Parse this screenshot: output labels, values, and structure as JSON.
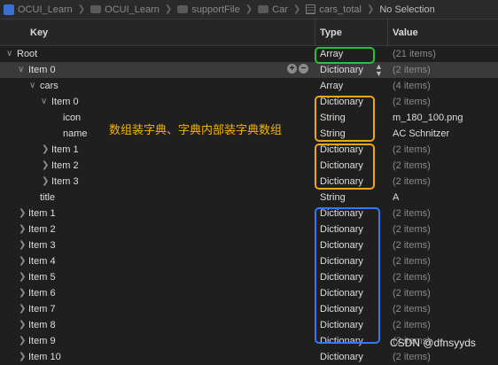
{
  "breadcrumbs": [
    "OCUI_Learn",
    "OCUI_Learn",
    "supportFile",
    "Car",
    "cars_total",
    "No Selection"
  ],
  "columns": {
    "key": "Key",
    "type": "Type",
    "value": "Value"
  },
  "rows": [
    {
      "key": "Root",
      "type": "Array",
      "value": "(21 items)"
    },
    {
      "key": "Item 0",
      "type": "Dictionary",
      "value": "(2 items)"
    },
    {
      "key": "cars",
      "type": "Array",
      "value": "(4 items)"
    },
    {
      "key": "Item 0",
      "type": "Dictionary",
      "value": "(2 items)"
    },
    {
      "key": "icon",
      "type": "String",
      "value": "m_180_100.png"
    },
    {
      "key": "name",
      "type": "String",
      "value": "AC Schnitzer"
    },
    {
      "key": "Item 1",
      "type": "Dictionary",
      "value": "(2 items)"
    },
    {
      "key": "Item 2",
      "type": "Dictionary",
      "value": "(2 items)"
    },
    {
      "key": "Item 3",
      "type": "Dictionary",
      "value": "(2 items)"
    },
    {
      "key": "title",
      "type": "String",
      "value": "A"
    },
    {
      "key": "Item 1",
      "type": "Dictionary",
      "value": "(2 items)"
    },
    {
      "key": "Item 2",
      "type": "Dictionary",
      "value": "(2 items)"
    },
    {
      "key": "Item 3",
      "type": "Dictionary",
      "value": "(2 items)"
    },
    {
      "key": "Item 4",
      "type": "Dictionary",
      "value": "(2 items)"
    },
    {
      "key": "Item 5",
      "type": "Dictionary",
      "value": "(2 items)"
    },
    {
      "key": "Item 6",
      "type": "Dictionary",
      "value": "(2 items)"
    },
    {
      "key": "Item 7",
      "type": "Dictionary",
      "value": "(2 items)"
    },
    {
      "key": "Item 8",
      "type": "Dictionary",
      "value": "(2 items)"
    },
    {
      "key": "Item 9",
      "type": "Dictionary",
      "value": "(2 items)"
    },
    {
      "key": "Item 10",
      "type": "Dictionary",
      "value": "(2 items)"
    }
  ],
  "annotation": "数组装字典、字典内部装字典数组",
  "watermark": "CSDN @dfnsyyds",
  "colors": {
    "green_box": "#27c23b",
    "orange_box": "#f1a512",
    "blue_box": "#2f7bf5",
    "annotation": "#f4b400"
  }
}
